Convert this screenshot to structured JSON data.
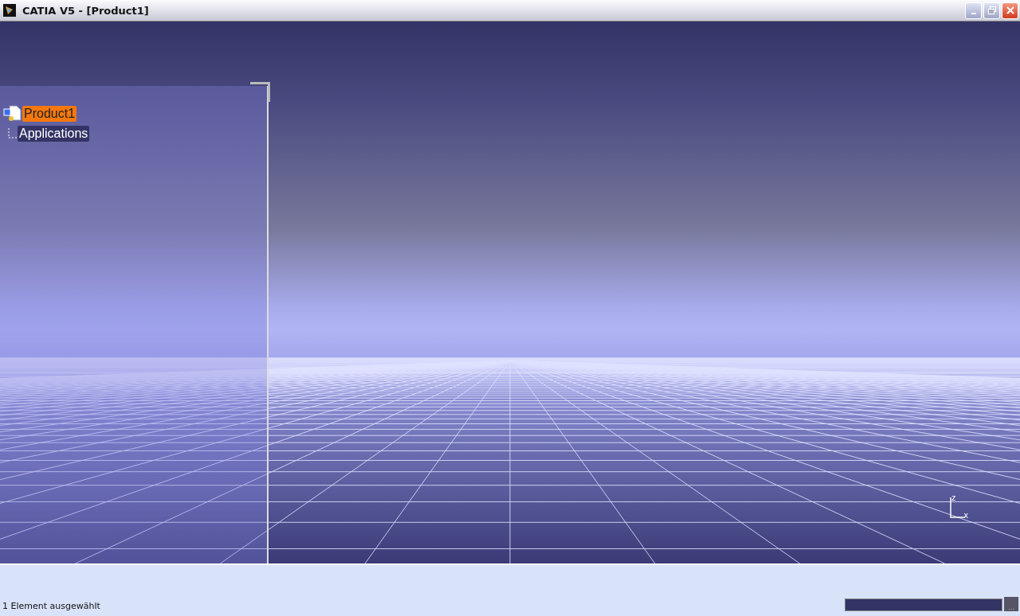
{
  "window": {
    "title": "CATIA V5 - [Product1]"
  },
  "tree": {
    "items": [
      {
        "label": "Product1",
        "selected": true
      },
      {
        "label": "Applications",
        "selected": false
      }
    ]
  },
  "compass": {
    "axis_z": "z",
    "axis_x": "x"
  },
  "status_bar": {
    "message": "1 Element ausgewählt",
    "command_button": "..."
  }
}
